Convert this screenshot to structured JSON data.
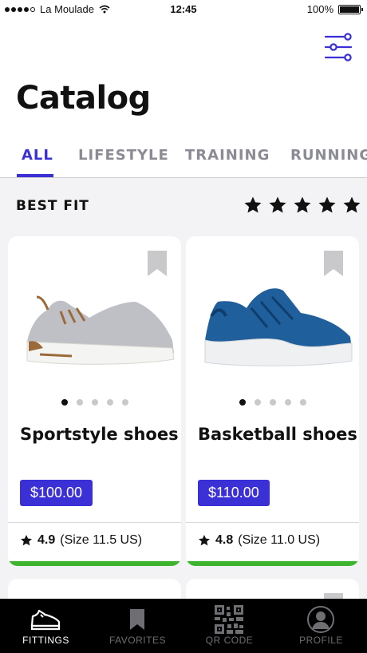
{
  "status_bar": {
    "carrier": "La Moulade",
    "time": "12:45",
    "battery": "100%"
  },
  "header": {
    "title": "Catalog"
  },
  "tabs": [
    {
      "label": "ALL",
      "active": true
    },
    {
      "label": "LIFESTYLE",
      "active": false
    },
    {
      "label": "TRAINING",
      "active": false
    },
    {
      "label": "RUNNING",
      "active": false
    }
  ],
  "section": {
    "label": "BEST FIT",
    "stars": 5
  },
  "products": [
    {
      "name": "Sportstyle shoes",
      "price": "$100.00",
      "rating": "4.9",
      "size_text": "(Size 11.5 US)",
      "image_colors": {
        "upper": "#bfc0c6",
        "sole": "#f4f4f2",
        "accent": "#9a6a3a"
      }
    },
    {
      "name": "Basketball shoes",
      "price": "$110.00",
      "rating": "4.8",
      "size_text": "(Size 11.0 US)",
      "image_colors": {
        "upper": "#1f5f9c",
        "sole": "#eef0f2",
        "accent": "#0f3e6e"
      }
    }
  ],
  "bottom_nav": [
    {
      "label": "FITTINGS",
      "icon": "sneaker-icon",
      "active": true
    },
    {
      "label": "FAVORITES",
      "icon": "bookmark-icon",
      "active": false
    },
    {
      "label": "QR CODE",
      "icon": "qr-code-icon",
      "active": false
    },
    {
      "label": "PROFILE",
      "icon": "profile-icon",
      "active": false
    }
  ],
  "colors": {
    "accent": "#3b2fd6",
    "success_bar": "#3cb42e",
    "tab_inactive": "#8b8b93"
  }
}
